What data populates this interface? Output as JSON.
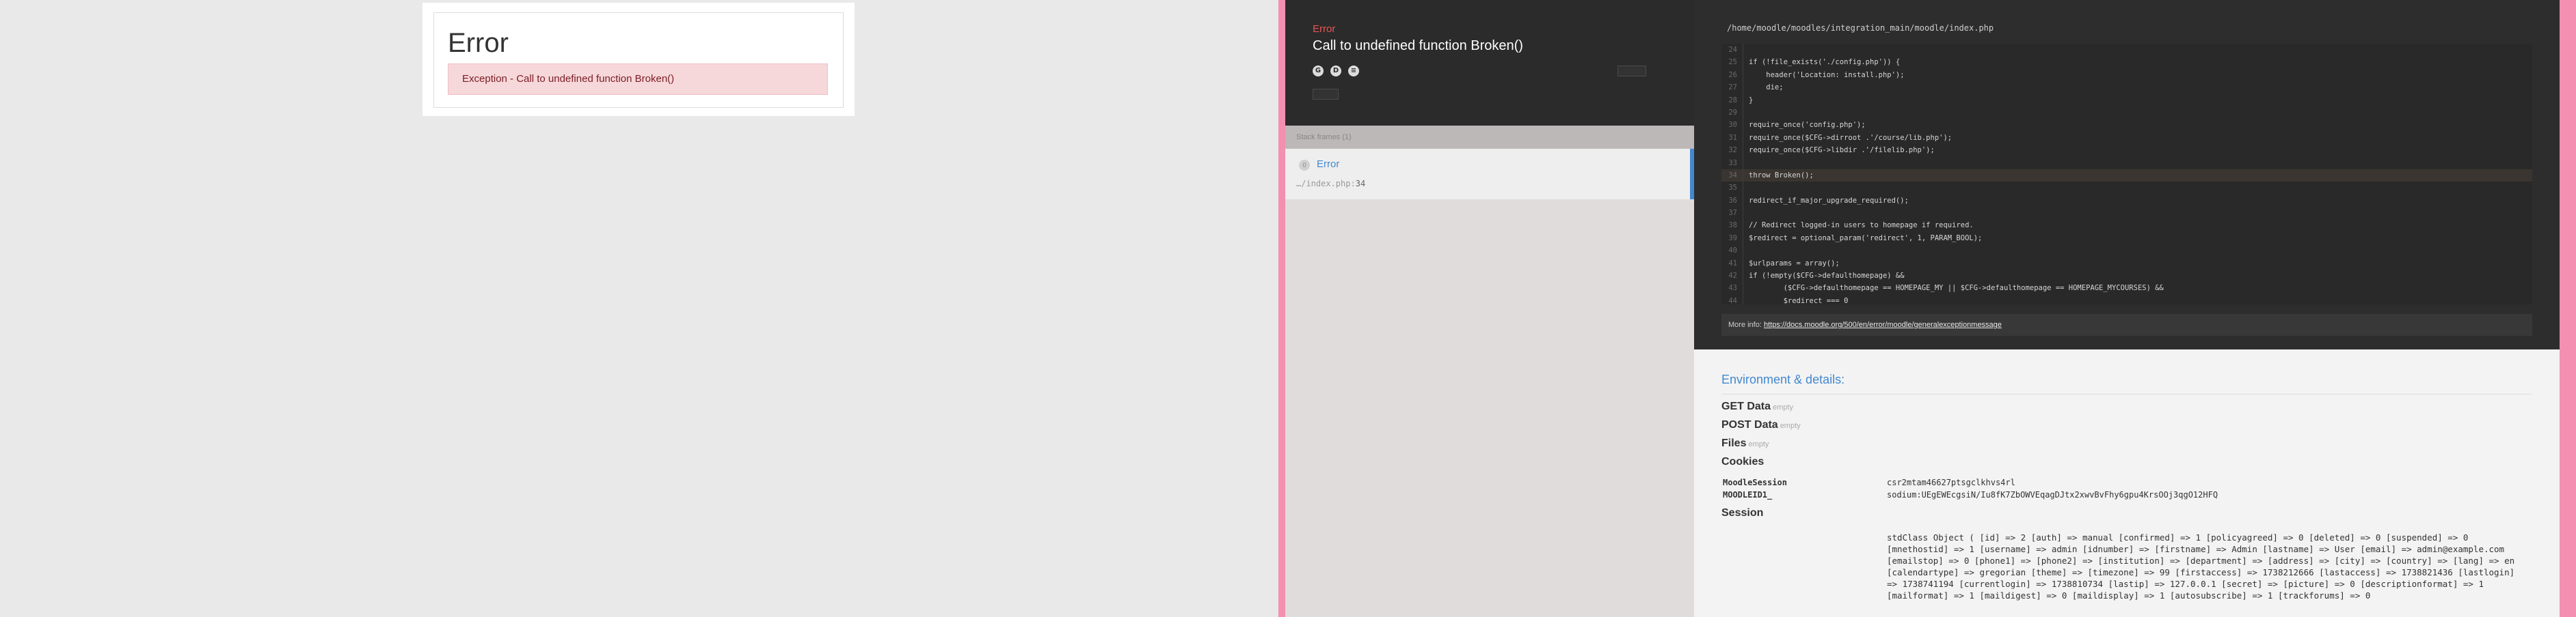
{
  "moodle_error": {
    "title": "Error",
    "alert": "Exception - Call to undefined function Broken()"
  },
  "whoops": {
    "exception_type": "Error",
    "exception_message": "Call to undefined function Broken()",
    "search_icons": [
      "google-icon",
      "duckduckgo-icon",
      "stackoverflow-icon"
    ],
    "stack_frames_label": "Stack frames (1)",
    "frame": {
      "index": "0",
      "class": "Error",
      "file": "…/index.php",
      "line": "34"
    },
    "file_path": "/home/moodle/moodles/integration_main/moodle/index.php",
    "code_lines": [
      {
        "n": "24",
        "code": ""
      },
      {
        "n": "25",
        "code": "if (!file_exists('./config.php')) {"
      },
      {
        "n": "26",
        "code": "    header('Location: install.php');"
      },
      {
        "n": "27",
        "code": "    die;"
      },
      {
        "n": "28",
        "code": "}"
      },
      {
        "n": "29",
        "code": ""
      },
      {
        "n": "30",
        "code": "require_once('config.php');"
      },
      {
        "n": "31",
        "code": "require_once($CFG->dirroot .'/course/lib.php');"
      },
      {
        "n": "32",
        "code": "require_once($CFG->libdir .'/filelib.php');"
      },
      {
        "n": "33",
        "code": ""
      },
      {
        "n": "34",
        "code": "throw Broken();"
      },
      {
        "n": "35",
        "code": ""
      },
      {
        "n": "36",
        "code": "redirect_if_major_upgrade_required();"
      },
      {
        "n": "37",
        "code": ""
      },
      {
        "n": "38",
        "code": "// Redirect logged-in users to homepage if required."
      },
      {
        "n": "39",
        "code": "$redirect = optional_param('redirect', 1, PARAM_BOOL);"
      },
      {
        "n": "40",
        "code": ""
      },
      {
        "n": "41",
        "code": "$urlparams = array();"
      },
      {
        "n": "42",
        "code": "if (!empty($CFG->defaulthomepage) &&"
      },
      {
        "n": "43",
        "code": "        ($CFG->defaulthomepage == HOMEPAGE_MY || $CFG->defaulthomepage == HOMEPAGE_MYCOURSES) &&"
      },
      {
        "n": "44",
        "code": "        $redirect === 0"
      }
    ],
    "highlight_line": "34",
    "more_info_label": "More info:",
    "more_info_url": "https://docs.moodle.org/500/en/error/moodle/generalexceptionmessage",
    "env_title": "Environment & details:",
    "get_data": "GET Data",
    "post_data": "POST Data",
    "files": "Files",
    "empty_label": "empty",
    "cookies": "Cookies",
    "cookie_rows": [
      {
        "key": "MoodleSession",
        "value": "csr2mtam46627ptsgclkhvs4rl"
      },
      {
        "key": "MOODLEID1_",
        "value": "sodium:UEgEWEcgsiN/Iu8fK7ZbOWVEqagDJtx2xwvBvFhy6gpu4KrsOOj3qgO12HFQ"
      }
    ],
    "session": "Session",
    "session_value": "stdClass Object ( [id] => 2 [auth] => manual [confirmed] => 1 [policyagreed] => 0 [deleted] => 0 [suspended] => 0 [mnethostid] => 1 [username] => admin [idnumber] => [firstname] => Admin [lastname] => User [email] => admin@example.com [emailstop] => 0 [phone1] => [phone2] => [institution] => [department] => [address] => [city] => [country] => [lang] => en [calendartype] => gregorian [theme] => [timezone] => 99 [firstaccess] => 1738212666 [lastaccess] => 1738821436 [lastlogin] => 1738741194 [currentlogin] => 1738810734 [lastip] => 127.0.0.1 [secret] => [picture] => 0 [descriptionformat] => 1 [mailformat] => 1 [maildigest] => 0 [maildisplay] => 1 [autosubscribe] => 1 [trackforums] => 0"
  }
}
